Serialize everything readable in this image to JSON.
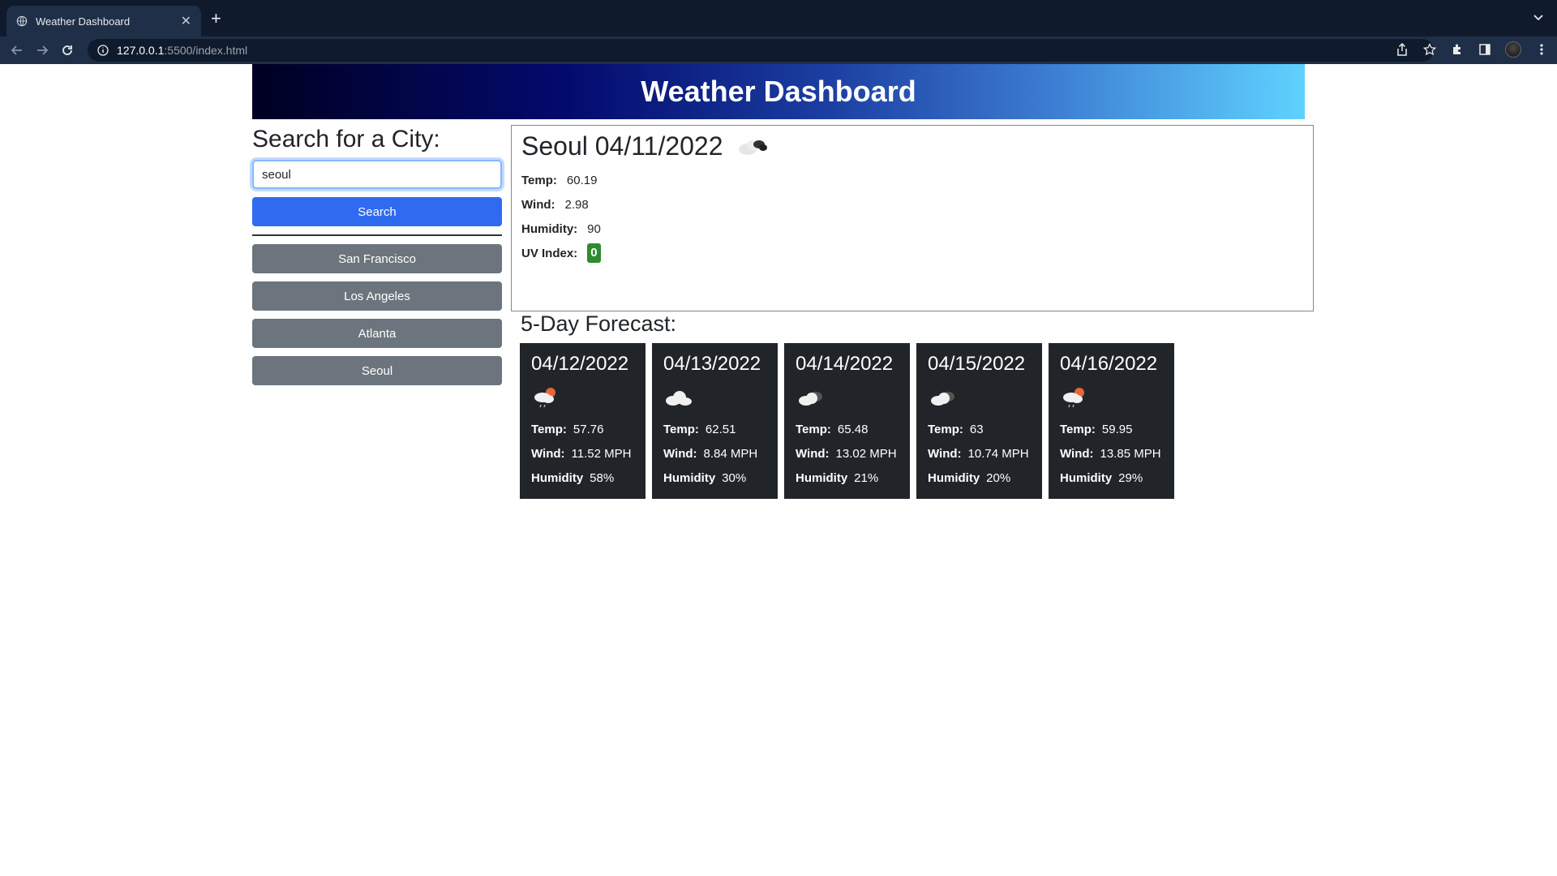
{
  "browser": {
    "tab_title": "Weather Dashboard",
    "url_host": "127.0.0.1",
    "url_path": ":5500/index.html"
  },
  "header": {
    "title": "Weather Dashboard"
  },
  "search": {
    "heading": "Search for a City:",
    "value": "seoul",
    "button_label": "Search",
    "history": [
      "San Francisco",
      "Los Angeles",
      "Atlanta",
      "Seoul"
    ]
  },
  "current": {
    "title": "Seoul 04/11/2022",
    "icon": "broken-clouds-icon",
    "temp_label": "Temp:",
    "temp": "60.19",
    "wind_label": "Wind:",
    "wind": "2.98",
    "humidity_label": "Humidity:",
    "humidity": "90",
    "uv_label": "UV Index:",
    "uv": "0",
    "uv_color": "#2e8b2e"
  },
  "forecast": {
    "heading": "5-Day Forecast:",
    "days": [
      {
        "date": "04/12/2022",
        "icon": "light-rain-icon",
        "temp_label": "Temp:",
        "temp": "57.76",
        "wind_label": "Wind:",
        "wind": "11.52 MPH",
        "humidity_label": "Humidity",
        "humidity": "58%"
      },
      {
        "date": "04/13/2022",
        "icon": "cloud-icon",
        "temp_label": "Temp:",
        "temp": "62.51",
        "wind_label": "Wind:",
        "wind": "8.84 MPH",
        "humidity_label": "Humidity",
        "humidity": "30%"
      },
      {
        "date": "04/14/2022",
        "icon": "broken-clouds-icon",
        "temp_label": "Temp:",
        "temp": "65.48",
        "wind_label": "Wind:",
        "wind": "13.02 MPH",
        "humidity_label": "Humidity",
        "humidity": "21%"
      },
      {
        "date": "04/15/2022",
        "icon": "broken-clouds-icon",
        "temp_label": "Temp:",
        "temp": "63",
        "wind_label": "Wind:",
        "wind": "10.74 MPH",
        "humidity_label": "Humidity",
        "humidity": "20%"
      },
      {
        "date": "04/16/2022",
        "icon": "light-rain-icon",
        "temp_label": "Temp:",
        "temp": "59.95",
        "wind_label": "Wind:",
        "wind": "13.85 MPH",
        "humidity_label": "Humidity",
        "humidity": "29%"
      }
    ]
  },
  "colors": {
    "search_button": "#2f6bf1",
    "history_button": "#6c757d",
    "card_bg": "#212529"
  }
}
